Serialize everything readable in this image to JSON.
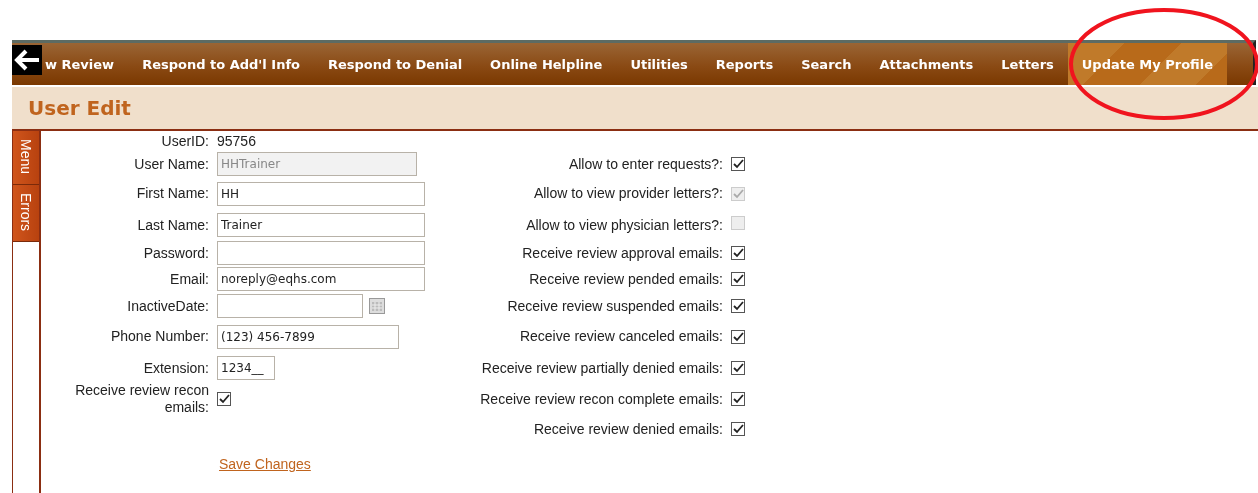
{
  "nav": {
    "items": [
      {
        "label": "w Review",
        "selected": false
      },
      {
        "label": "Respond to Add'l Info",
        "selected": false
      },
      {
        "label": "Respond to Denial",
        "selected": false
      },
      {
        "label": "Online Helpline",
        "selected": false
      },
      {
        "label": "Utilities",
        "selected": false
      },
      {
        "label": "Reports",
        "selected": false
      },
      {
        "label": "Search",
        "selected": false
      },
      {
        "label": "Attachments",
        "selected": false
      },
      {
        "label": "Letters",
        "selected": false
      },
      {
        "label": "Update My Profile",
        "selected": true
      }
    ]
  },
  "header": {
    "title": "User Edit"
  },
  "side_tabs": [
    {
      "label": "Menu"
    },
    {
      "label": "Errors"
    }
  ],
  "left_fields": [
    {
      "kind": "static",
      "label": "UserID:",
      "value": "95756"
    },
    {
      "kind": "text",
      "label": "User Name:",
      "value": "HHTrainer",
      "disabled": true
    },
    {
      "kind": "text",
      "label": "First Name:",
      "value": "HH",
      "disabled": false
    },
    {
      "kind": "text",
      "label": "Last Name:",
      "value": "Trainer",
      "disabled": false
    },
    {
      "kind": "text",
      "label": "Password:",
      "disabled": false
    },
    {
      "kind": "text",
      "label": "Email:",
      "value": "noreply@eqhs.com",
      "disabled": false
    },
    {
      "kind": "date",
      "label": "InactiveDate:",
      "disabled": false
    },
    {
      "kind": "text",
      "label": "Phone Number:",
      "value": "(123) 456-7899",
      "disabled": false
    },
    {
      "kind": "text",
      "label": "Extension:",
      "value": "1234__",
      "disabled": false
    },
    {
      "kind": "checkbox",
      "label": "Receive review recon emails:",
      "checked": true,
      "disabled": false
    }
  ],
  "right_fields": [
    {
      "label": "Allow to enter requests?:",
      "checked": true,
      "disabled": false
    },
    {
      "label": "Allow to view provider letters?:",
      "checked": true,
      "disabled": true
    },
    {
      "label": "Allow to view physician letters?:",
      "checked": false,
      "disabled": true
    },
    {
      "label": "Receive review approval emails:",
      "checked": true,
      "disabled": false
    },
    {
      "label": "Receive review pended emails:",
      "checked": true,
      "disabled": false
    },
    {
      "label": "Receive review suspended emails:",
      "checked": true,
      "disabled": false
    },
    {
      "label": "Receive review canceled emails:",
      "checked": true,
      "disabled": false
    },
    {
      "label": "Receive review partially denied emails:",
      "checked": true,
      "disabled": false
    },
    {
      "label": "Receive review recon complete emails:",
      "checked": true,
      "disabled": false
    },
    {
      "label": "Receive review denied emails:",
      "checked": true,
      "disabled": false
    }
  ],
  "save_link": "Save Changes"
}
